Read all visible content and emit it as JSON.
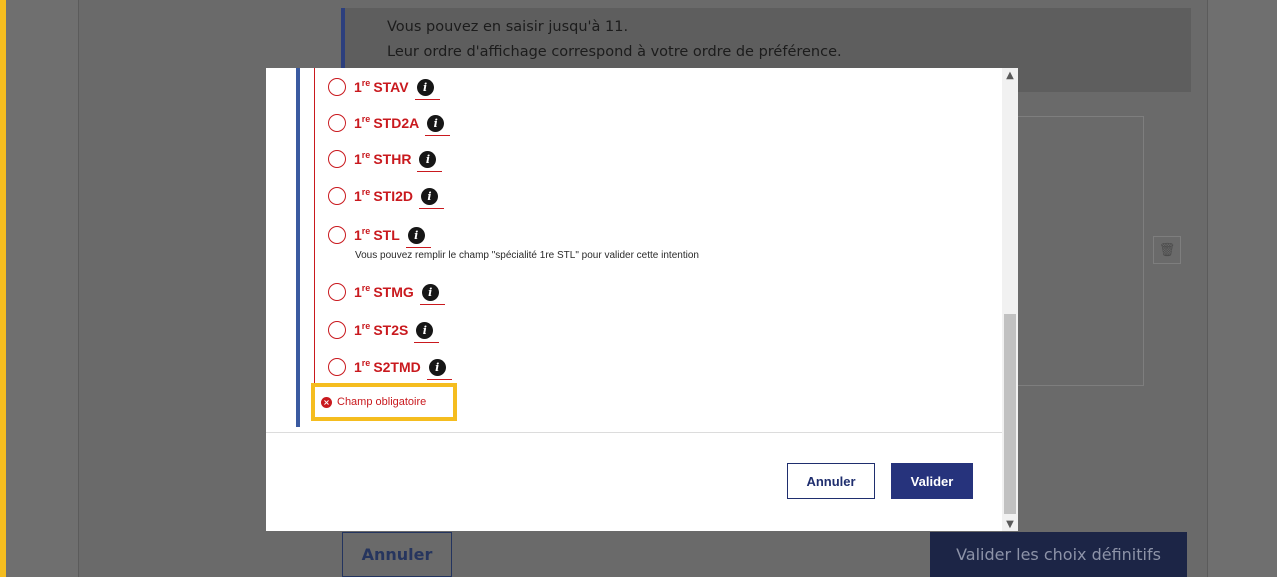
{
  "background": {
    "info_line_1": "Vous pouvez en saisir jusqu'à 11.",
    "info_line_2": "Leur ordre d'affichage correspond à votre ordre de préférence.",
    "cancel_label": "Annuler",
    "validate_label": "Valider les choix définitifs",
    "trash_icon": "trash-icon"
  },
  "modal": {
    "options": [
      {
        "prefix": "1",
        "sup": "re",
        "label": "STAV"
      },
      {
        "prefix": "1",
        "sup": "re",
        "label": "STD2A"
      },
      {
        "prefix": "1",
        "sup": "re",
        "label": "STHR"
      },
      {
        "prefix": "1",
        "sup": "re",
        "label": "STI2D"
      },
      {
        "prefix": "1",
        "sup": "re",
        "label": "STL"
      },
      {
        "prefix": "1",
        "sup": "re",
        "label": "STMG"
      },
      {
        "prefix": "1",
        "sup": "re",
        "label": "ST2S"
      },
      {
        "prefix": "1",
        "sup": "re",
        "label": "S2TMD"
      }
    ],
    "stl_hint": "Vous pouvez remplir le champ \"spécialité 1re STL\" pour valider cette intention",
    "error_text": "Champ obligatoire",
    "cancel_label": "Annuler",
    "validate_label": "Valider",
    "info_icon_glyph": "i",
    "error_icon_glyph": "×"
  },
  "colors": {
    "accent_red": "#c9191e",
    "primary_blue": "#26337c",
    "highlight_yellow": "#f5bd1f"
  }
}
